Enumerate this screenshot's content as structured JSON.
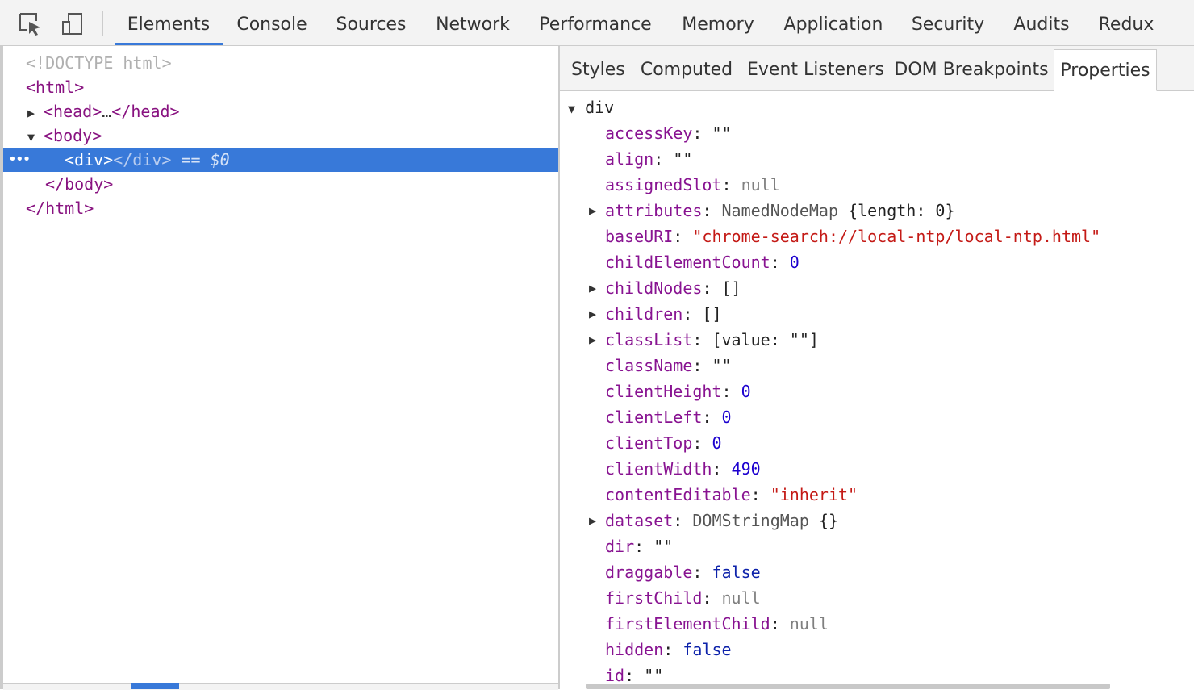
{
  "main_tabs": [
    "Elements",
    "Console",
    "Sources",
    "Network",
    "Performance",
    "Memory",
    "Application",
    "Security",
    "Audits",
    "Redux"
  ],
  "active_main_tab": "Elements",
  "dom": {
    "doctype": "<!DOCTYPE html>",
    "html_open": "<html>",
    "head_open": "<head>",
    "head_ellipsis": "…",
    "head_close": "</head>",
    "body_open": "<body>",
    "div_open": "<div>",
    "div_close": "</div>",
    "selected_marker": "== $0",
    "body_close": "</body>",
    "html_close": "</html>",
    "dots": "•••"
  },
  "sub_tabs": [
    "Styles",
    "Computed",
    "Event Listeners",
    "DOM Breakpoints",
    "Properties"
  ],
  "active_sub_tab": "Properties",
  "props": {
    "header": "div",
    "items": [
      {
        "name": "accessKey",
        "value": "\"\""
      },
      {
        "name": "align",
        "value": "\"\""
      },
      {
        "name": "assignedSlot",
        "value": "null"
      },
      {
        "name": "attributes",
        "value": "NamedNodeMap",
        "extra": "{length: 0}"
      },
      {
        "name": "baseURI",
        "value": "\"chrome-search://local-ntp/local-ntp.html\""
      },
      {
        "name": "childElementCount",
        "value": "0"
      },
      {
        "name": "childNodes",
        "value": "[]"
      },
      {
        "name": "children",
        "value": "[]"
      },
      {
        "name": "classList",
        "value": "[value: \"\"]"
      },
      {
        "name": "className",
        "value": "\"\""
      },
      {
        "name": "clientHeight",
        "value": "0"
      },
      {
        "name": "clientLeft",
        "value": "0"
      },
      {
        "name": "clientTop",
        "value": "0"
      },
      {
        "name": "clientWidth",
        "value": "490"
      },
      {
        "name": "contentEditable",
        "value": "\"inherit\""
      },
      {
        "name": "dataset",
        "value": "DOMStringMap",
        "extra": "{}"
      },
      {
        "name": "dir",
        "value": "\"\""
      },
      {
        "name": "draggable",
        "value": "false"
      },
      {
        "name": "firstChild",
        "value": "null"
      },
      {
        "name": "firstElementChild",
        "value": "null"
      },
      {
        "name": "hidden",
        "value": "false"
      },
      {
        "name": "id",
        "value": "\"\""
      }
    ]
  }
}
